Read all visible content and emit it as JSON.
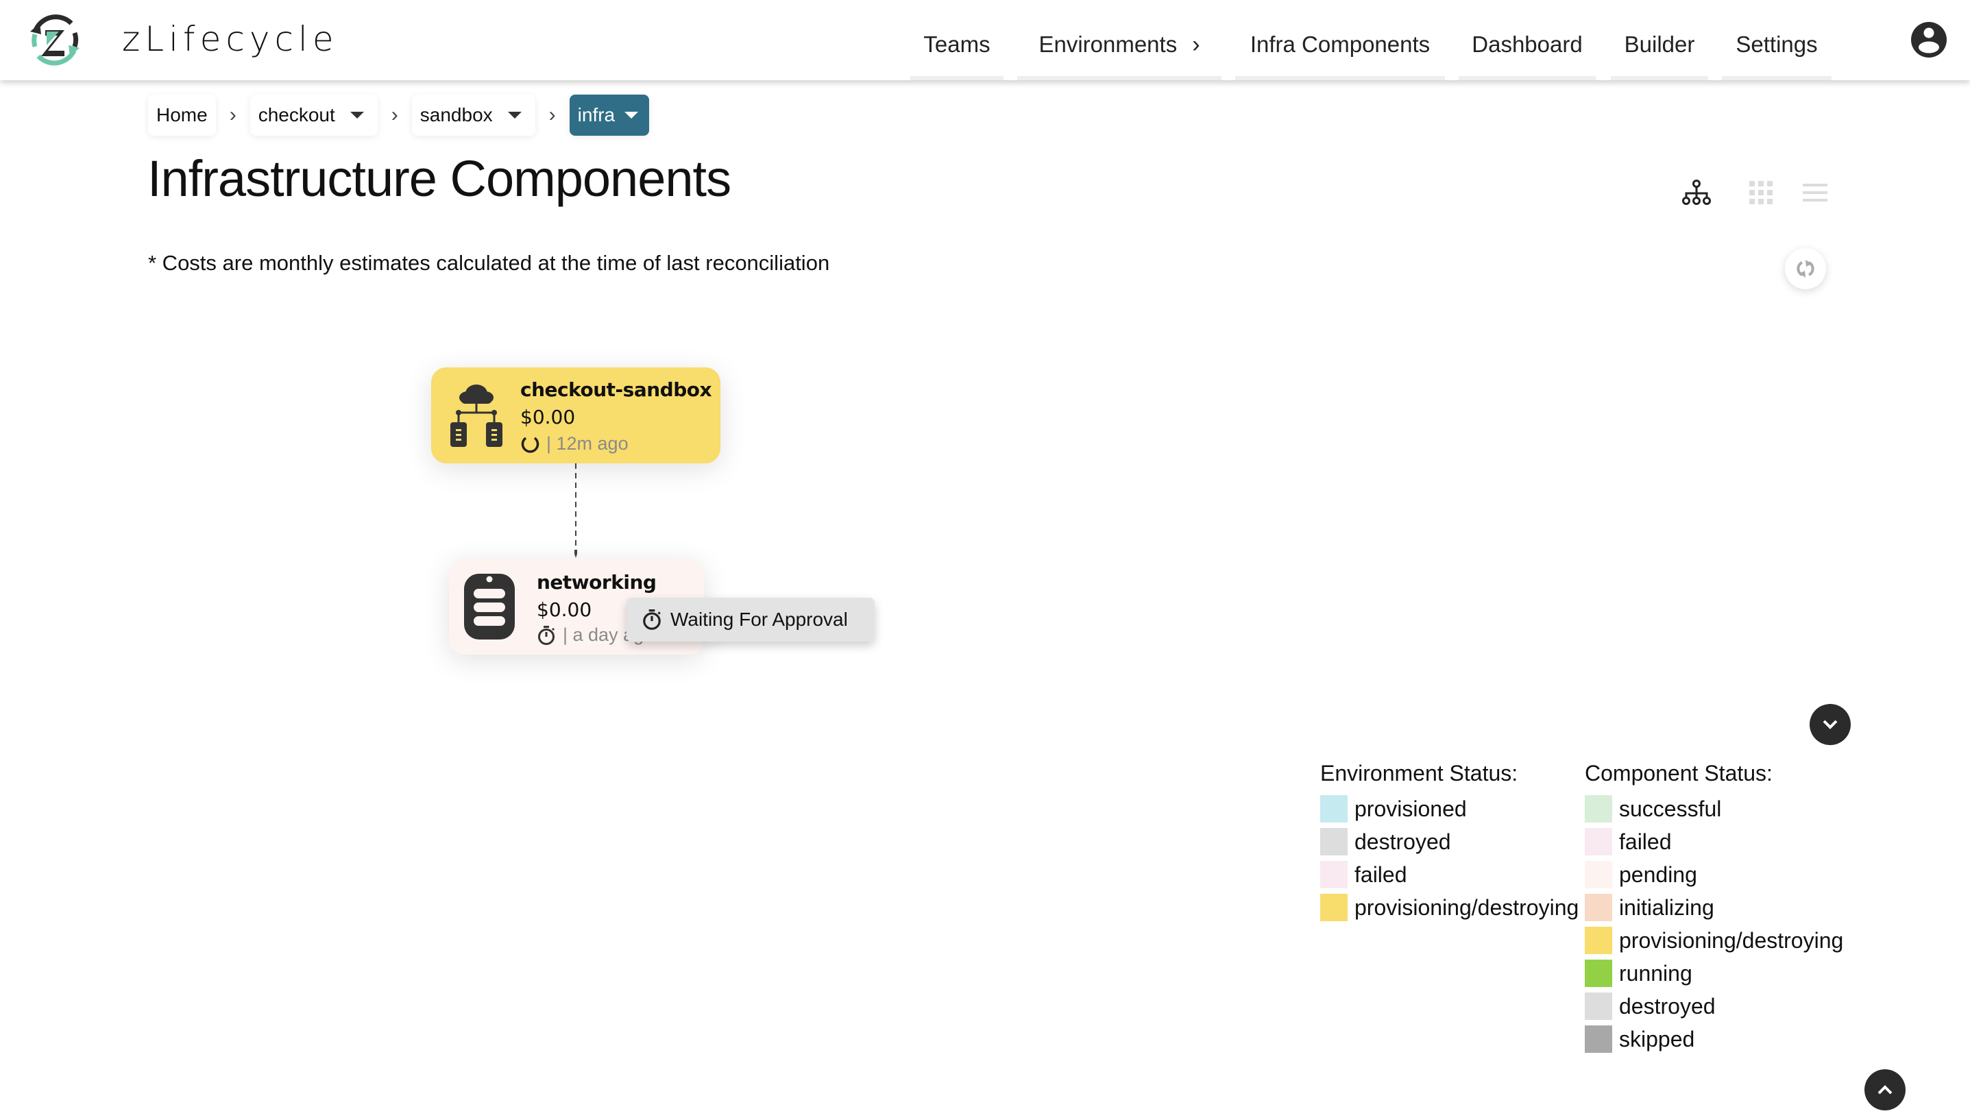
{
  "app": {
    "brand": "zLifecycle"
  },
  "nav": {
    "items": [
      {
        "label": "Teams"
      },
      {
        "label": "Environments",
        "chevron": "›"
      },
      {
        "label": "Infra Components"
      },
      {
        "label": "Dashboard"
      },
      {
        "label": "Builder"
      },
      {
        "label": "Settings"
      }
    ],
    "user_icon": "account-circle-icon"
  },
  "breadcrumb": {
    "items": [
      {
        "label": "Home",
        "dropdown": false
      },
      {
        "label": "checkout",
        "dropdown": true
      },
      {
        "label": "sandbox",
        "dropdown": true
      },
      {
        "label": "infra",
        "dropdown": true,
        "active": true
      }
    ],
    "separator": "›"
  },
  "page": {
    "title": "Infrastructure Components",
    "subtitle": "* Costs are monthly estimates calculated at the time of last reconciliation"
  },
  "view_switcher": {
    "options": [
      {
        "name": "tree-view",
        "active": true
      },
      {
        "name": "grid-view",
        "active": false
      },
      {
        "name": "list-view",
        "active": false
      }
    ]
  },
  "graph": {
    "environment_node": {
      "name": "checkout-sandbox",
      "cost": "$0.00",
      "status_icon": "spinner-icon",
      "updated": "| 12m ago",
      "status": "provisioning/destroying"
    },
    "component_nodes": [
      {
        "name": "networking",
        "cost": "$0.00",
        "status_icon": "stopwatch-icon",
        "updated": "| a day ago",
        "status": "pending"
      }
    ],
    "tooltip": "Waiting For Approval"
  },
  "legend": {
    "environment": {
      "title": "Environment Status:",
      "items": [
        {
          "label": "provisioned",
          "color": "#c5eaf0"
        },
        {
          "label": "destroyed",
          "color": "#dddddd"
        },
        {
          "label": "failed",
          "color": "#f9e9f0"
        },
        {
          "label": "provisioning/destroying",
          "color": "#f8dc6c"
        }
      ]
    },
    "component": {
      "title": "Component Status:",
      "items": [
        {
          "label": "successful",
          "color": "#d9eed9"
        },
        {
          "label": "failed",
          "color": "#f9e9f0"
        },
        {
          "label": "pending",
          "color": "#fdf4f1"
        },
        {
          "label": "initializing",
          "color": "#f7d9c6"
        },
        {
          "label": "provisioning/destroying",
          "color": "#f8dc6c"
        },
        {
          "label": "running",
          "color": "#92d145"
        },
        {
          "label": "destroyed",
          "color": "#dddddd"
        },
        {
          "label": "skipped",
          "color": "#a8a8a8"
        }
      ]
    }
  },
  "colors": {
    "accent": "#2f6e86",
    "dark": "#2b2b2b",
    "logo_green": "#6ec8a8"
  }
}
